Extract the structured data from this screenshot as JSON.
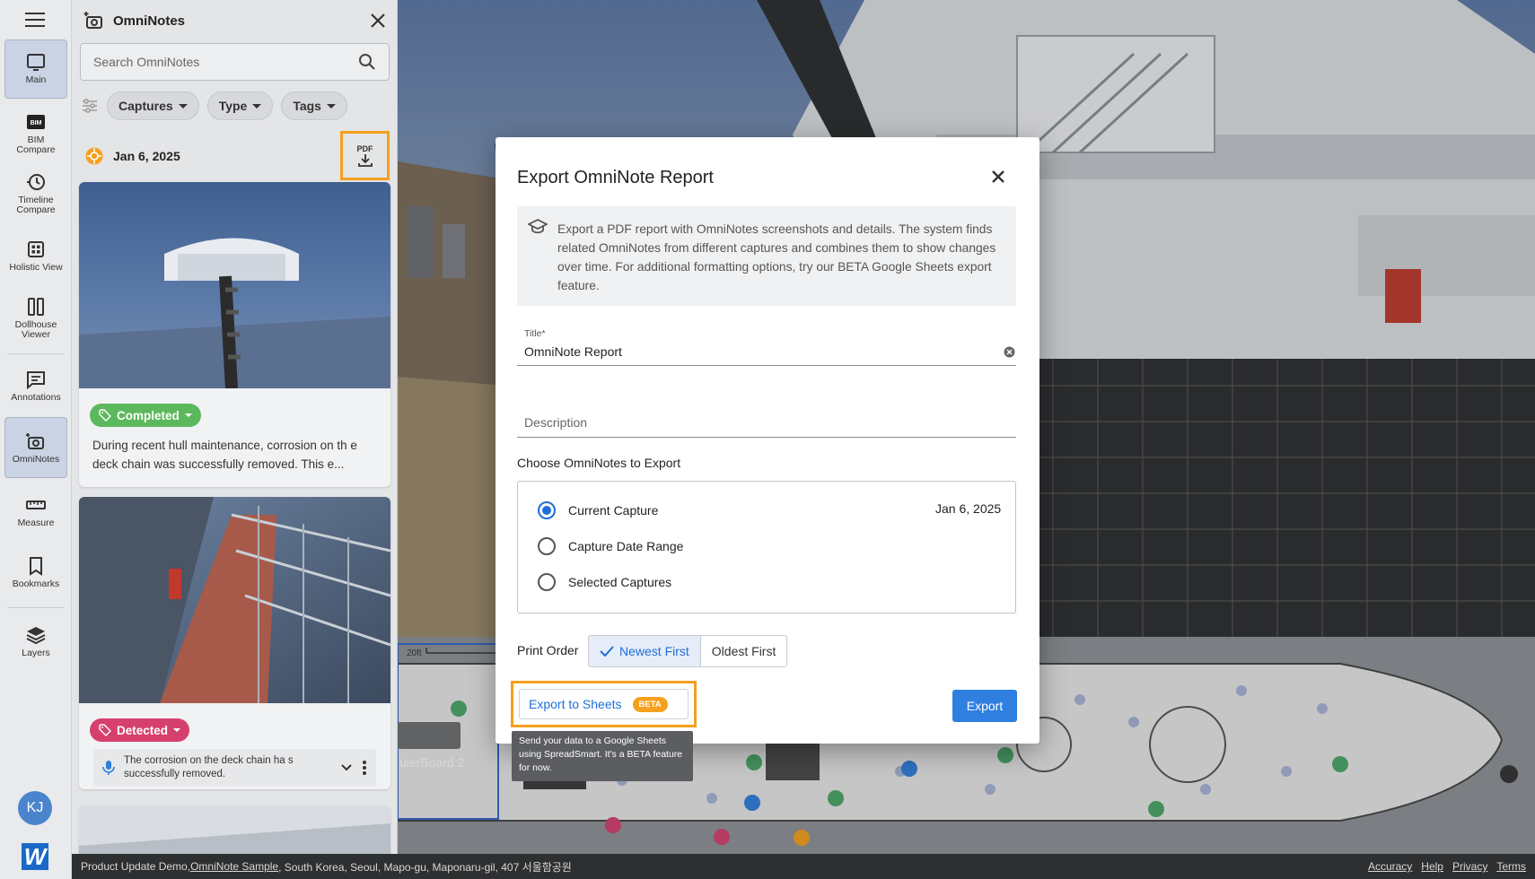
{
  "rail": {
    "items": [
      {
        "label": "Main"
      },
      {
        "label": "BIM\nCompare"
      },
      {
        "label": "Timeline\nCompare"
      },
      {
        "label": "Holistic View"
      },
      {
        "label": "Dollhouse\nViewer"
      },
      {
        "label": "Annotations"
      },
      {
        "label": "OmniNotes"
      },
      {
        "label": "Measure"
      },
      {
        "label": "Bookmarks"
      },
      {
        "label": "Layers"
      }
    ],
    "avatar_initials": "KJ",
    "logo_letter": "W"
  },
  "panel": {
    "title": "OmniNotes",
    "search_placeholder": "Search OmniNotes",
    "filters": [
      "Captures",
      "Type",
      "Tags"
    ],
    "date": "Jan 6, 2025",
    "pdf_label": "PDF",
    "cards": [
      {
        "tag": "Completed",
        "tag_color": "#5cb85c",
        "text": "During recent hull maintenance, corrosion on th e deck chain was successfully removed. This e..."
      },
      {
        "tag": "Detected",
        "tag_color": "#d6406f",
        "voice_text": "The corrosion on the deck chain ha s successfully removed."
      }
    ]
  },
  "map": {
    "scale_label": "20ft",
    "board_label": "ulerBoard 2"
  },
  "dialog": {
    "title": "Export OmniNote Report",
    "info": "Export a PDF report with OmniNotes screenshots and details. The system finds related OmniNotes from different captures and combines them to show changes over time. For additional formatting options, try our BETA Google Sheets export feature.",
    "title_field_label": "Title*",
    "title_field_value": "OmniNote Report",
    "description_placeholder": "Description",
    "choose_label": "Choose OmniNotes to Export",
    "options": [
      "Current Capture",
      "Capture Date Range",
      "Selected Captures"
    ],
    "selected_option": "Current Capture",
    "current_capture_date": "Jan 6, 2025",
    "print_order_label": "Print Order",
    "print_order_options": [
      "Newest First",
      "Oldest First"
    ],
    "print_order_selected": "Newest First",
    "sheets_button": "Export to Sheets",
    "beta_badge": "BETA",
    "export_button": "Export",
    "tooltip": "Send your data to a Google Sheets using SpreadSmart. It's a BETA feature for now."
  },
  "status": {
    "prefix": "Product Update Demo, ",
    "link": "OmniNote Sample",
    "location": ", South Korea, Seoul, Mapo-gu, Maponaru-gil, 407 서울함공원",
    "links": [
      "Accuracy",
      "Help",
      "Privacy",
      "Terms"
    ]
  },
  "colors": {
    "accent": "#1e6fd9",
    "highlight": "#f5a01f",
    "completed": "#5cb85c",
    "detected": "#d6406f"
  }
}
